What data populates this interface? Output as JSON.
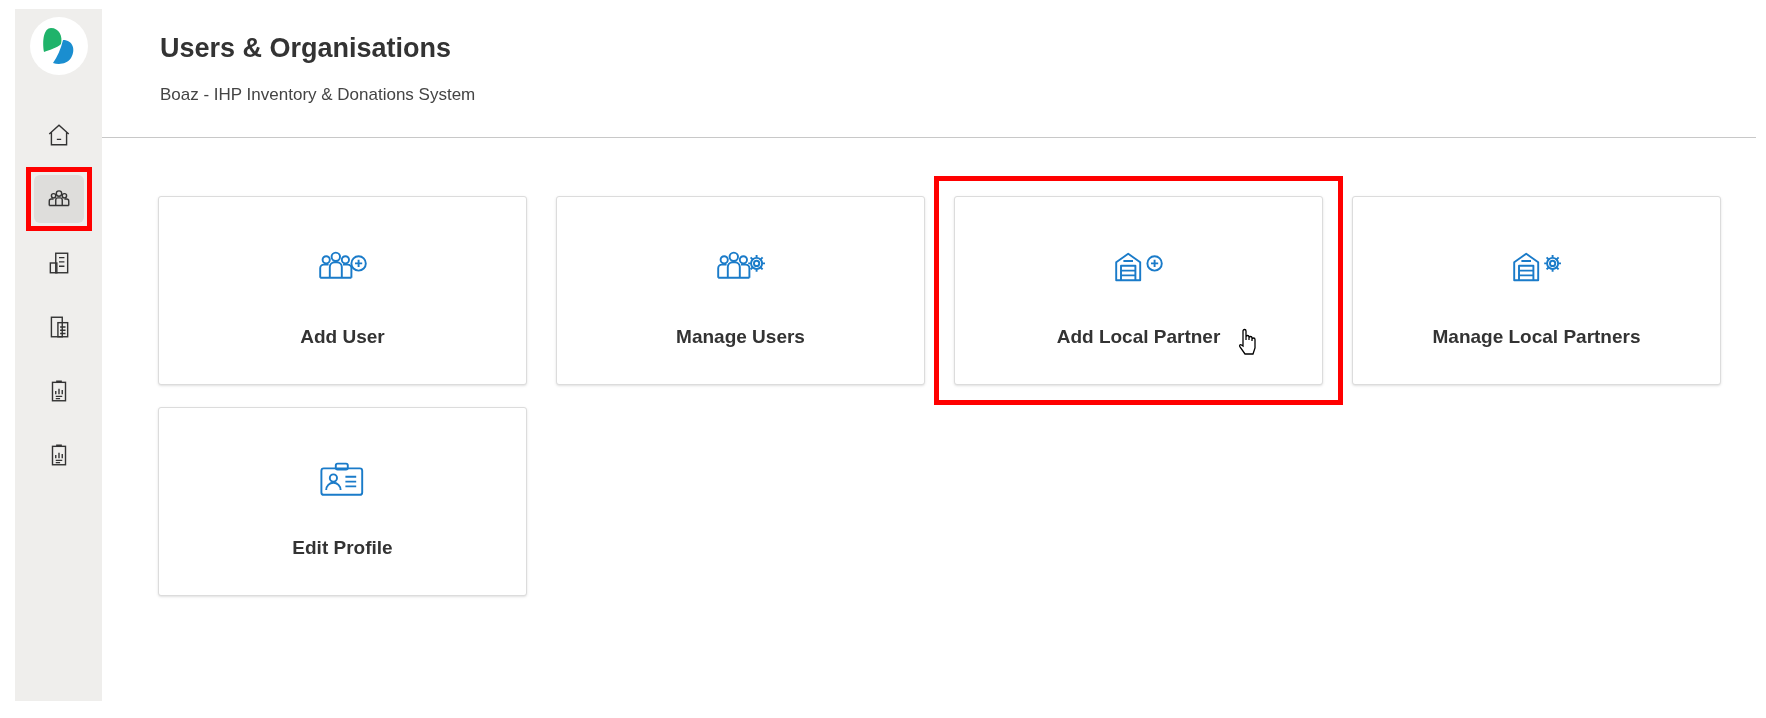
{
  "sidebar": {
    "items": [
      {
        "kind": "home",
        "selected": false,
        "highlighted": false
      },
      {
        "kind": "users",
        "selected": true,
        "highlighted": true
      },
      {
        "kind": "inventory",
        "selected": false,
        "highlighted": false
      },
      {
        "kind": "documents",
        "selected": false,
        "highlighted": false
      },
      {
        "kind": "report",
        "selected": false,
        "highlighted": false
      },
      {
        "kind": "report",
        "selected": false,
        "highlighted": false
      }
    ]
  },
  "header": {
    "title": "Users & Organisations",
    "subtitle": "Boaz - IHP Inventory & Donations System"
  },
  "cards": [
    {
      "kind": "add-user",
      "label": "Add User",
      "highlighted": false,
      "pointer": false
    },
    {
      "kind": "manage-users",
      "label": "Manage Users",
      "highlighted": false,
      "pointer": false
    },
    {
      "kind": "add-partner",
      "label": "Add Local Partner",
      "highlighted": true,
      "pointer": true
    },
    {
      "kind": "manage-partners",
      "label": "Manage Local Partners",
      "highlighted": false,
      "pointer": false
    },
    {
      "kind": "profile",
      "label": "Edit Profile",
      "highlighted": false,
      "pointer": false
    }
  ]
}
